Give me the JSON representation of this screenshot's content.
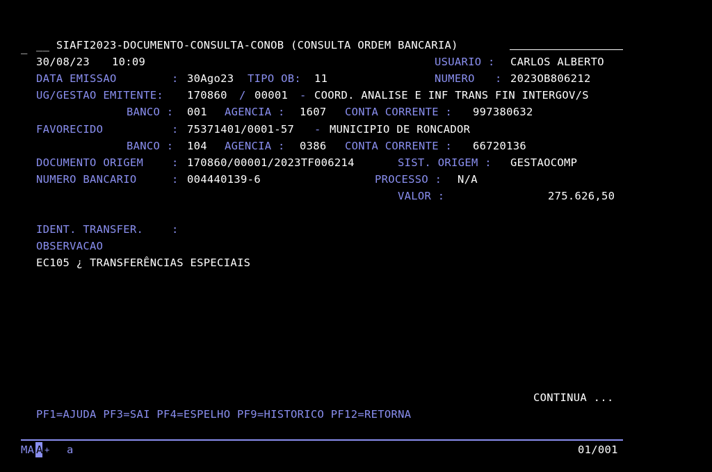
{
  "header": {
    "cursor_mark": "_",
    "title": "__ SIAFI2023-DOCUMENTO-CONSULTA-CONOB (CONSULTA ORDEM BANCARIA)",
    "date": "30/08/23",
    "time": "10:09",
    "usuario_label": "USUARIO :",
    "usuario": "CARLOS ALBERTO"
  },
  "fields": {
    "data_emissao_label": "DATA EMISSAO",
    "data_emissao_colon": ":",
    "data_emissao": "30Ago23",
    "tipo_ob_label": "TIPO OB:",
    "tipo_ob": "11",
    "numero_label": "NUMERO",
    "numero_colon": ":",
    "numero": "2023OB806212",
    "ug_label": "UG/GESTAO EMITENTE:",
    "ug_code": "170860",
    "ug_slash": "/",
    "gestao_code": "00001",
    "ug_dash": "-",
    "ug_name": "COORD. ANALISE E INF TRANS FIN INTERGOV/S",
    "banco1_label": "BANCO :",
    "banco1": "001",
    "agencia1_label": "AGENCIA :",
    "agencia1": "1607",
    "conta1_label": "CONTA CORRENTE :",
    "conta1": "997380632",
    "favorecido_label": "FAVORECIDO",
    "favorecido_colon": ":",
    "favorecido_cnpj": "75371401/0001-57",
    "favorecido_dash": "-",
    "favorecido_name": "MUNICIPIO DE RONCADOR",
    "banco2_label": "BANCO :",
    "banco2": "104",
    "agencia2_label": "AGENCIA :",
    "agencia2": "0386",
    "conta2_label": "CONTA CORRENTE :",
    "conta2": "66720136",
    "doc_origem_label": "DOCUMENTO ORIGEM",
    "doc_origem_colon": ":",
    "doc_origem": "170860/00001/2023TF006214",
    "sist_origem_label": "SIST. ORIGEM :",
    "sist_origem": "GESTAOCOMP",
    "num_bancario_label": "NUMERO BANCARIO",
    "num_bancario_colon": ":",
    "num_bancario": "004440139-6",
    "processo_label": "PROCESSO :",
    "processo": "N/A",
    "valor_label": "VALOR :",
    "valor": "275.626,50",
    "ident_label": "IDENT. TRANSFER.",
    "ident_colon": ":",
    "observacao_label": "OBSERVACAO",
    "observacao_text": "EC105 ¿ TRANSFERÊNCIAS ESPECIAIS"
  },
  "footer": {
    "continua": "CONTINUA ...",
    "pf_keys": "PF1=AJUDA PF3=SAI PF4=ESPELHO PF9=HISTORICO PF12=RETORNA",
    "status_ma": "MA",
    "status_a": "A",
    "status_plus": "+",
    "status_lower_a": "a",
    "page_indicator": "01/001"
  },
  "colors": {
    "background": "#000000",
    "text_white": "#ffffff",
    "text_blue": "#8a8ff0"
  }
}
